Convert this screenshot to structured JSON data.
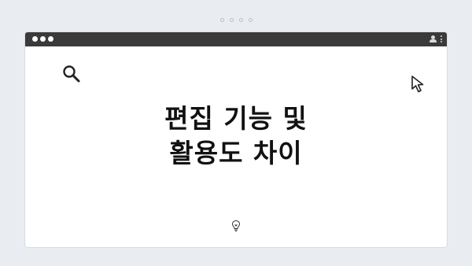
{
  "carousel": {
    "dot_count": 4
  },
  "window": {
    "titlebar_dots": 3,
    "icons": [
      "user-icon",
      "kebab-icon",
      "search-icon",
      "cursor-icon",
      "lightbulb-icon"
    ]
  },
  "headline": {
    "line1": "편집 기능 및",
    "line2": "활용도 차이"
  },
  "colors": {
    "background": "#e9edf2",
    "titlebar": "#3a3a3a",
    "window": "#ffffff",
    "text": "#111111"
  }
}
